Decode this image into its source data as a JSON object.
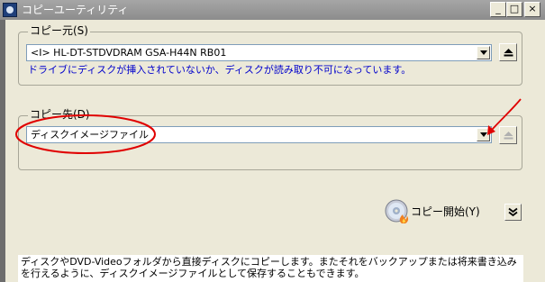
{
  "window": {
    "title": "コピーユーティリティ",
    "controls": {
      "minimize": "_",
      "maximize": "□",
      "close": "×"
    }
  },
  "source": {
    "legend": "コピー元(S)",
    "drive_value": "<I>  HL-DT-STDVDRAM GSA-H44N  RB01",
    "status_message": "ドライブにディスクが挿入されていないか、ディスクが読み取り不可になっています。",
    "status_color": "#0000cc"
  },
  "destination": {
    "legend": "コピー先(D)",
    "value": "ディスクイメージファイル"
  },
  "actions": {
    "start_copy_label": "コピー開始(Y)",
    "expand_icon": "double-chevron-down-icon",
    "eject_icon": "eject-icon"
  },
  "description": "ディスクやDVD-Videoフォルダから直接ディスクにコピーします。またそれをバックアップまたは将来書き込みを行えるように、ディスクイメージファイルとして保存することもできます。",
  "annotation": {
    "color": "#e00000"
  }
}
